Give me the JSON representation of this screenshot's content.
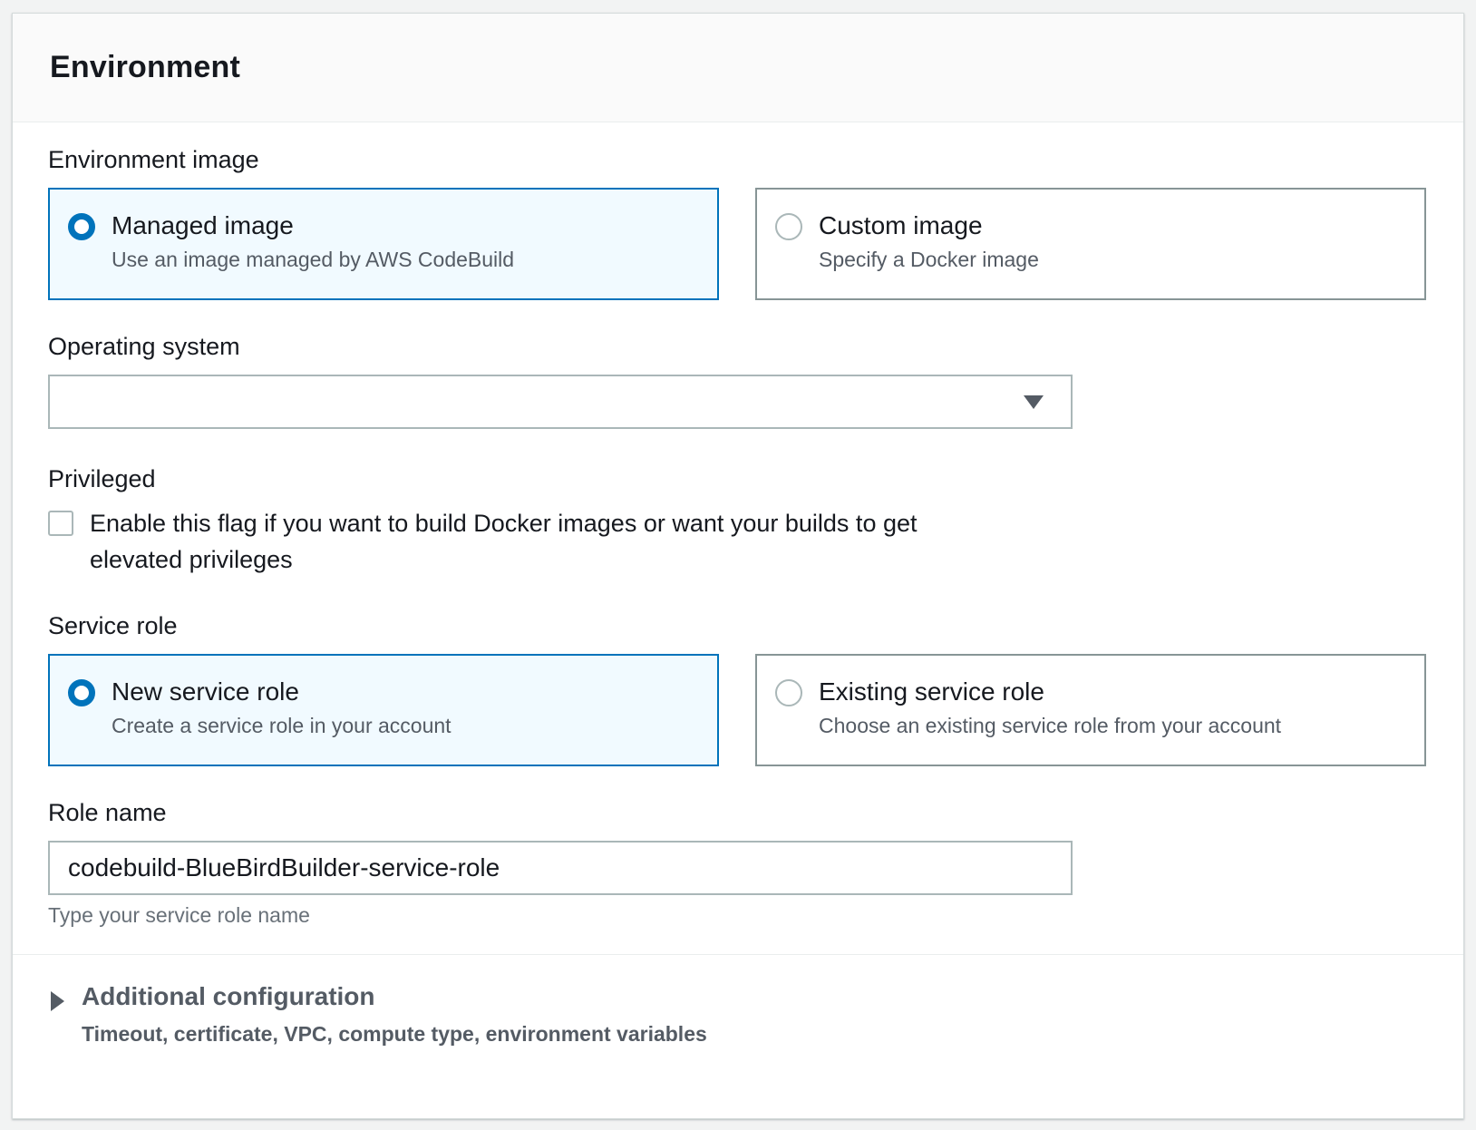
{
  "panel": {
    "title": "Environment"
  },
  "environment_image": {
    "label": "Environment image",
    "options": [
      {
        "title": "Managed image",
        "description": "Use an image managed by AWS CodeBuild",
        "selected": true
      },
      {
        "title": "Custom image",
        "description": "Specify a Docker image",
        "selected": false
      }
    ]
  },
  "operating_system": {
    "label": "Operating system",
    "value": ""
  },
  "privileged": {
    "label": "Privileged",
    "checkbox_label": "Enable this flag if you want to build Docker images or want your builds to get elevated privileges",
    "checked": false
  },
  "service_role": {
    "label": "Service role",
    "options": [
      {
        "title": "New service role",
        "description": "Create a service role in your account",
        "selected": true
      },
      {
        "title": "Existing service role",
        "description": "Choose an existing service role from your account",
        "selected": false
      }
    ]
  },
  "role_name": {
    "label": "Role name",
    "value": "codebuild-BlueBirdBuilder-service-role",
    "hint": "Type your service role name"
  },
  "additional_configuration": {
    "title": "Additional configuration",
    "description": "Timeout, certificate, VPC, compute type, environment variables",
    "expanded": false
  },
  "colors": {
    "accent": "#0073bb",
    "selected_tile_bg": "#f1faff",
    "border": "#aab7b8",
    "text": "#16191f",
    "secondary_text": "#545b64"
  }
}
